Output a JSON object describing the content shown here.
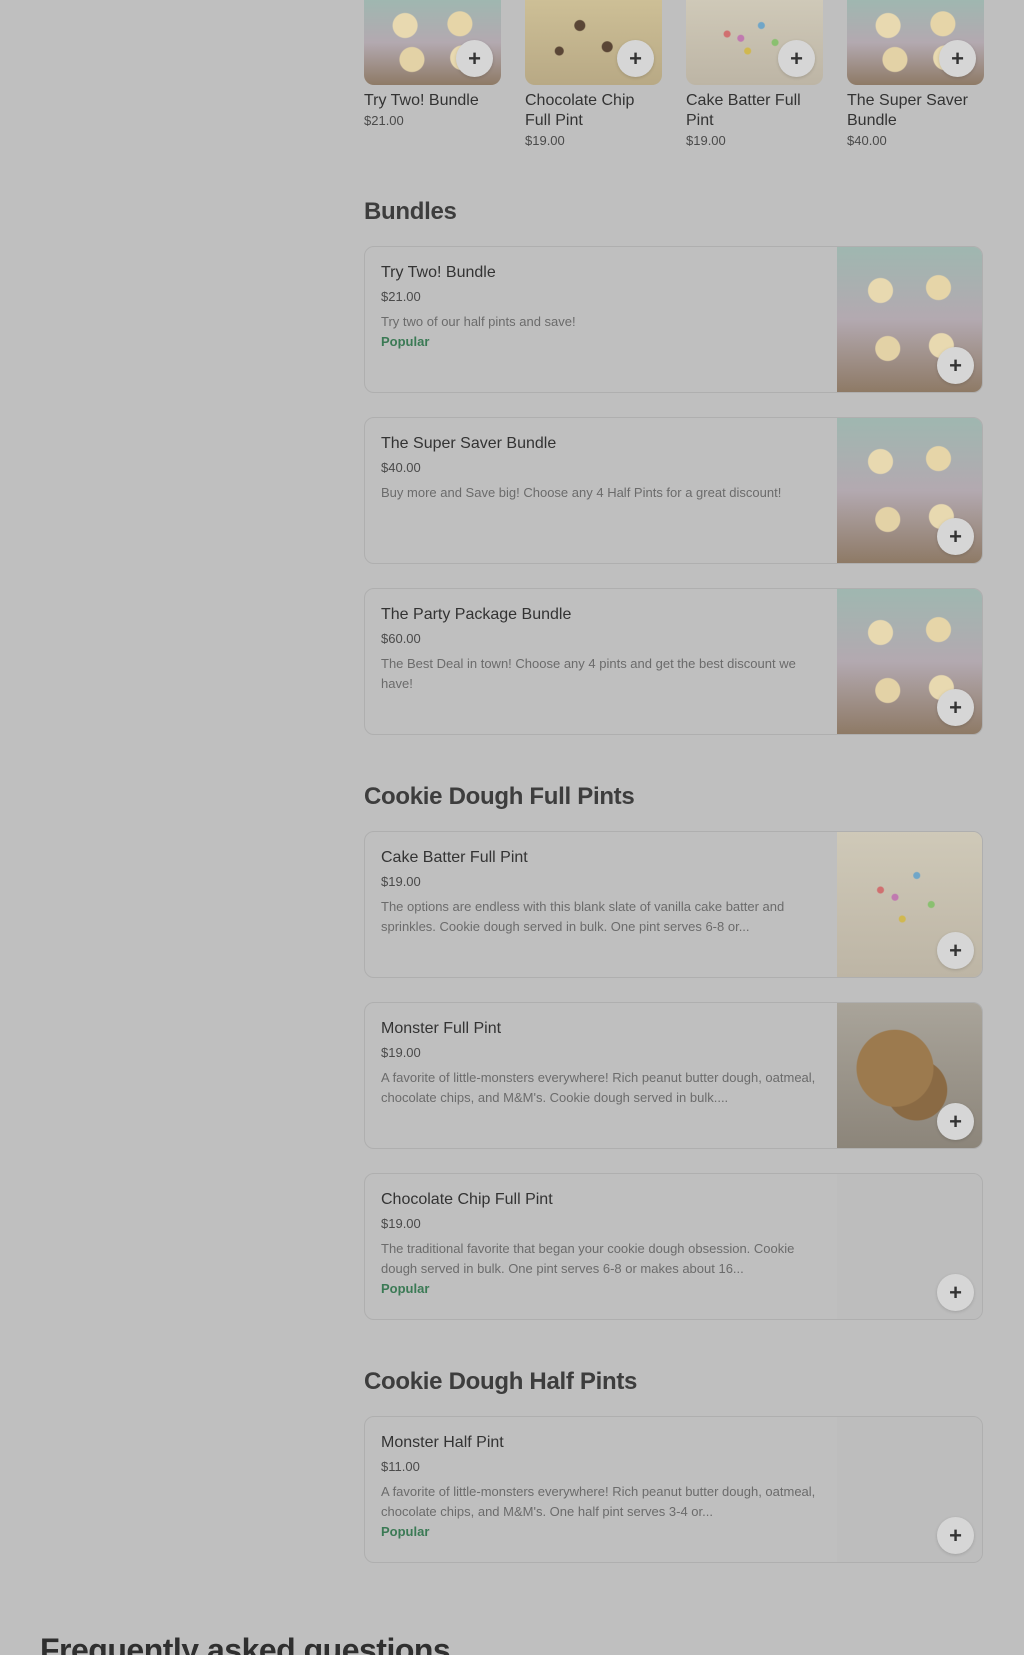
{
  "featured": [
    {
      "title": "Try Two! Bundle",
      "price": "$21.00",
      "image": "cups-photo"
    },
    {
      "title": "Chocolate Chip Full Pint",
      "price": "$19.00",
      "image": "chocolate-chip-photo"
    },
    {
      "title": "Cake Batter Full Pint",
      "price": "$19.00",
      "image": "sprinkle-photo"
    },
    {
      "title": "The Super Saver Bundle",
      "price": "$40.00",
      "image": "cups-photo"
    }
  ],
  "add_icon": "+",
  "sections": {
    "bundles": {
      "title": "Bundles",
      "items": [
        {
          "title": "Try Two! Bundle",
          "price": "$21.00",
          "desc": "Try two of our half pints and save!",
          "badge": "Popular"
        },
        {
          "title": "The Super Saver Bundle",
          "price": "$40.00",
          "desc": "Buy more and Save big! Choose any 4 Half Pints for a great discount!",
          "badge": ""
        },
        {
          "title": "The Party Package Bundle",
          "price": "$60.00",
          "desc": "The Best Deal in town! Choose any 4 pints and get the best discount we have!",
          "badge": ""
        }
      ]
    },
    "full_pints": {
      "title": "Cookie Dough Full Pints",
      "items": [
        {
          "title": "Cake Batter Full Pint",
          "price": "$19.00",
          "desc": "The options are endless with this blank slate of vanilla cake batter and sprinkles. Cookie dough served in bulk. One pint serves 6-8 or...",
          "badge": ""
        },
        {
          "title": "Monster Full Pint",
          "price": "$19.00",
          "desc": "A favorite of little-monsters everywhere! Rich peanut butter dough, oatmeal, chocolate chips, and M&M's. Cookie dough served in bulk....",
          "badge": ""
        },
        {
          "title": "Chocolate Chip Full Pint",
          "price": "$19.00",
          "desc": "The traditional favorite that began your cookie dough obsession. Cookie dough served in bulk. One pint serves 6-8 or makes about 16...",
          "badge": "Popular"
        }
      ]
    },
    "half_pints": {
      "title": "Cookie Dough Half Pints",
      "items": [
        {
          "title": "Monster Half Pint",
          "price": "$11.00",
          "desc": "A favorite of little-monsters everywhere! Rich peanut butter dough, oatmeal, chocolate chips, and M&M's. One half pint serves 3-4 or...",
          "badge": "Popular"
        }
      ]
    }
  },
  "faq_title": "Frequently asked questions"
}
